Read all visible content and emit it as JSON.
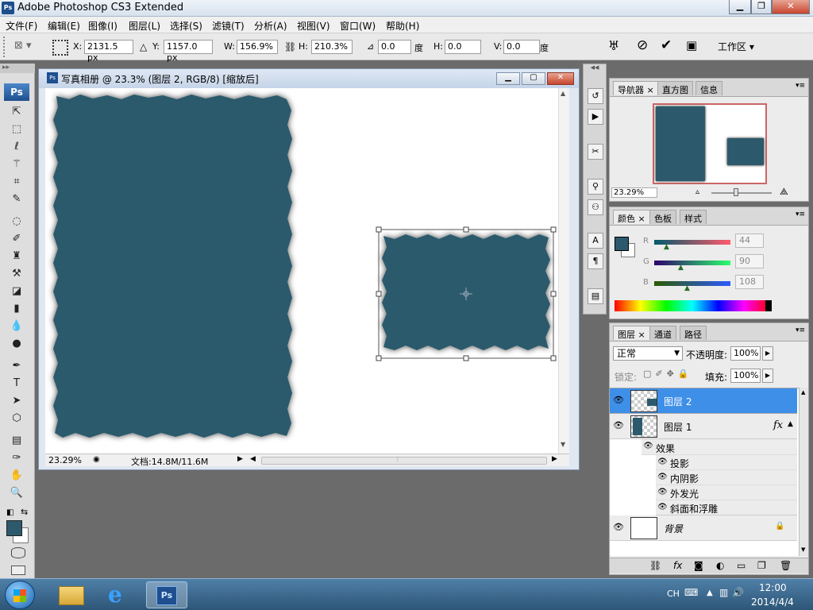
{
  "window": {
    "app_title": "Adobe Photoshop CS3 Extended"
  },
  "menu": [
    "文件(F)",
    "编辑(E)",
    "图像(I)",
    "图层(L)",
    "选择(S)",
    "滤镜(T)",
    "分析(A)",
    "视图(V)",
    "窗口(W)",
    "帮助(H)"
  ],
  "options": {
    "x_label": "X:",
    "x_value": "2131.5 px",
    "y_label": "Y:",
    "y_value": "1157.0 px",
    "w_label": "W:",
    "w_value": "156.9%",
    "h_label": "H:",
    "h_value": "210.3%",
    "rot_value": "0.0",
    "rot_unit": "度",
    "hskew_label": "H:",
    "hskew_value": "0.0",
    "vskew_label": "V:",
    "vskew_value": "0.0",
    "skew_unit": "度",
    "workspace_label": "工作区 ▾"
  },
  "document": {
    "title": "写真相册 @ 23.3% (图层 2, RGB/8) [缩放后]",
    "zoom": "23.29%",
    "doc_info": "文档:14.8M/11.6M"
  },
  "navigator": {
    "tabs": [
      "导航器",
      "直方图",
      "信息"
    ],
    "zoom": "23.29%"
  },
  "color_panel": {
    "tabs": [
      "颜色",
      "色板",
      "样式"
    ],
    "r_label": "R",
    "r": "44",
    "g_label": "G",
    "g": "90",
    "b_label": "B",
    "b": "108",
    "foreground": "#2c5a6c"
  },
  "layers_panel": {
    "tabs": [
      "图层",
      "通道",
      "路径"
    ],
    "blend_mode": "正常",
    "opacity_label": "不透明度:",
    "opacity": "100%",
    "lock_label": "锁定:",
    "fill_label": "填充:",
    "fill": "100%",
    "layers": [
      {
        "name": "图层 2",
        "selected": true
      },
      {
        "name": "图层 1",
        "fx": "fx"
      },
      {
        "name": "背景"
      }
    ],
    "effects_label": "效果",
    "effects": [
      "投影",
      "内阴影",
      "外发光",
      "斜面和浮雕"
    ]
  },
  "taskbar": {
    "lang": "CH",
    "time": "12:00",
    "date": "2014/4/4"
  },
  "colors": {
    "teal": "#2c5a6c",
    "selected_layer": "#3e8fe8"
  }
}
